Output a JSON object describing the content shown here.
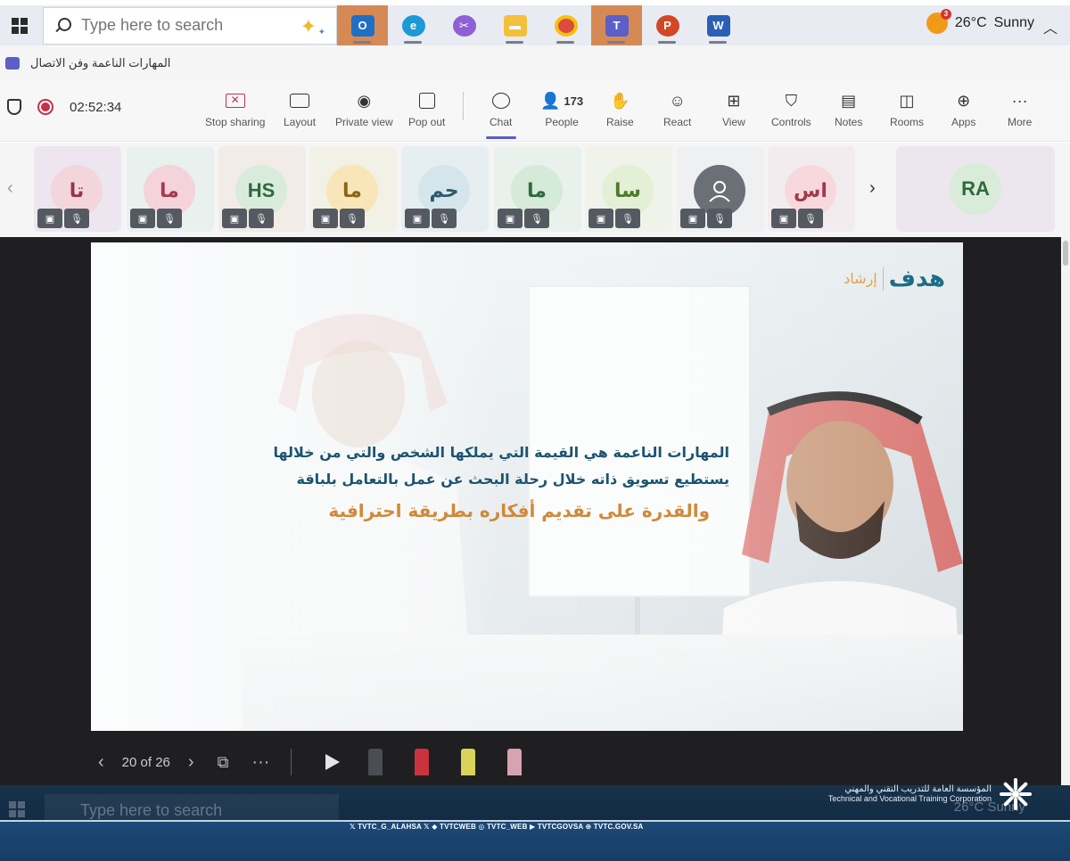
{
  "taskbar": {
    "search_placeholder": "Type here to search",
    "apps": [
      "outlook-icon",
      "edge-icon",
      "snipping-icon",
      "file-explorer-icon",
      "chrome-icon",
      "teams-icon",
      "powerpoint-icon",
      "word-icon"
    ],
    "weather": {
      "temp": "26°C",
      "condition": "Sunny",
      "badge": "3"
    }
  },
  "meeting": {
    "title": "المهارات الناعمة وفن الاتصال",
    "timer": "02:52:34",
    "controls": {
      "stop_sharing": "Stop sharing",
      "layout": "Layout",
      "private_view": "Private view",
      "pop_out": "Pop out",
      "chat": "Chat",
      "people": "People",
      "people_count": "173",
      "raise": "Raise",
      "react": "React",
      "view": "View",
      "controls": "Controls",
      "notes": "Notes",
      "rooms": "Rooms",
      "apps": "Apps",
      "more": "More"
    },
    "participants": [
      {
        "initials": "تا",
        "bg": "#ede6f0",
        "avbg": "#f3d6dc",
        "color": "#9a3448"
      },
      {
        "initials": "ما",
        "bg": "#e8f1ee",
        "avbg": "#f5d3da",
        "color": "#a53a52"
      },
      {
        "initials": "HS",
        "bg": "#f1ece7",
        "avbg": "#d9ecdc",
        "color": "#2f6a3d"
      },
      {
        "initials": "ما",
        "bg": "#f2f1e5",
        "avbg": "#f8e6b9",
        "color": "#8a6516"
      },
      {
        "initials": "حم",
        "bg": "#e6eef1",
        "avbg": "#d4e6ec",
        "color": "#2e5a6a"
      },
      {
        "initials": "ما",
        "bg": "#e9f1ec",
        "avbg": "#d5ead8",
        "color": "#2f6a3d"
      },
      {
        "initials": "سا",
        "bg": "#f0f3e9",
        "avbg": "#e3f0d6",
        "color": "#4e7a2c"
      },
      {
        "initials": "",
        "bg": "#eef0f1",
        "avbg": "#6b6f76",
        "color": "#ffffff"
      },
      {
        "initials": "اس",
        "bg": "#f3ecee",
        "avbg": "#f7d9dd",
        "color": "#a3394d"
      }
    ],
    "featured": {
      "initials": "RA",
      "bg": "#ece6ef",
      "avbg": "#d8ecd9",
      "color": "#2f6a3d"
    }
  },
  "slide": {
    "logo_brand": "هدف",
    "logo_sub": "إرشاد",
    "line1": "المهارات الناعمة هي القيمة التي يملكها الشخص والتي من خلالها",
    "line2": "يستطيع تسويق ذاته خلال رحلة البحث عن عمل بالتعامل بلباقة",
    "line3": "والقدرة على تقديم أفكاره بطريقة احترافية",
    "page": "20 of 26"
  },
  "ghost_taskbar": {
    "search_placeholder": "Type here to search",
    "weather": "26°C  Sunny"
  },
  "branding": {
    "org_ar": "المؤسسة العامة للتدريب التقني والمهني",
    "org_en": "Technical and Vocational Training Corporation",
    "social": "𝕏 TVTC_G_ALAHSA  𝕏 ◆ TVTCWEB  ◎ TVTC_WEB  ▶ TVTCGOVSA  ⊕ TVTC.GOV.SA"
  }
}
